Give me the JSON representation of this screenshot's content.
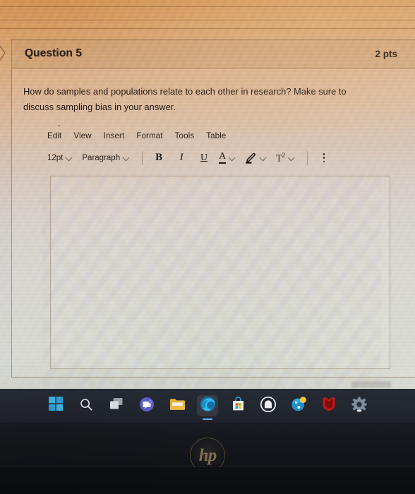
{
  "quiz": {
    "question_title": "Question 5",
    "points": "2 pts",
    "question_text": "How do samples and populations relate to each other in research? Make sure to discuss sampling bias in your answer.",
    "answer_value": "",
    "answer_placeholder": ""
  },
  "editor": {
    "menu": [
      {
        "label": "Edit"
      },
      {
        "label": "View"
      },
      {
        "label": "Insert"
      },
      {
        "label": "Format"
      },
      {
        "label": "Tools"
      },
      {
        "label": "Table"
      }
    ],
    "font_size": "12pt",
    "block_format": "Paragraph",
    "bold_label": "B",
    "italic_label": "I",
    "underline_label": "U",
    "text_color_label": "A",
    "superscript_label": "T",
    "superscript_exponent": "2",
    "highlight_icon": "highlighter-pen-icon",
    "more_options_icon": "kebab-menu-icon"
  },
  "taskbar": {
    "items": [
      {
        "name": "start-button",
        "icon": "windows-logo-icon"
      },
      {
        "name": "search-button",
        "icon": "search-icon"
      },
      {
        "name": "task-view-button",
        "icon": "task-view-icon"
      },
      {
        "name": "chat-button",
        "icon": "teams-chat-icon"
      },
      {
        "name": "file-explorer-button",
        "icon": "folder-icon"
      },
      {
        "name": "edge-button",
        "icon": "microsoft-edge-icon",
        "active": true
      },
      {
        "name": "store-button",
        "icon": "microsoft-store-icon"
      },
      {
        "name": "app-button",
        "icon": "arch-home-icon"
      },
      {
        "name": "xbox-button",
        "icon": "globe-badge-icon"
      },
      {
        "name": "mcafee-button",
        "icon": "shield-icon"
      },
      {
        "name": "settings-button",
        "icon": "gear-icon"
      }
    ]
  },
  "device": {
    "brand_logo": "hp"
  },
  "colors": {
    "screen_warm": "#d49a5e",
    "screen_cool": "#dadbd5",
    "taskbar": "#232730",
    "bezel": "#14161b",
    "edge_blue": "#3aa0dc",
    "mcafee_red": "#c01818",
    "hp_logo": "#8e7a55"
  }
}
